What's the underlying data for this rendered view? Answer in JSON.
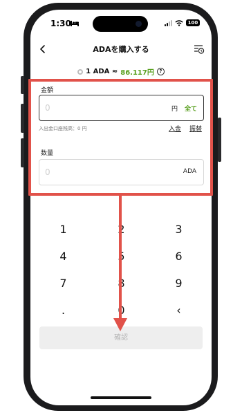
{
  "status_bar": {
    "time": "1:30",
    "battery": "100"
  },
  "nav": {
    "title": "ADAを購入する"
  },
  "rate": {
    "lead": "1 ADA ≈",
    "value": "86.117円"
  },
  "amount": {
    "label": "金額",
    "placeholder": "0",
    "unit": "円",
    "all_label": "全て",
    "balance_text": "入出金口座残高：0 円",
    "deposit_label": "入金",
    "transfer_label": "振替"
  },
  "quantity": {
    "label": "数量",
    "placeholder": "0",
    "unit": "ADA"
  },
  "keypad": {
    "keys": [
      "1",
      "2",
      "3",
      "4",
      "5",
      "6",
      "7",
      "8",
      "9",
      ".",
      "0",
      "‹"
    ]
  },
  "confirm": {
    "label": "確認"
  },
  "annotation": {
    "color": "#e1524a"
  },
  "colors": {
    "accent_green": "#59a01f"
  },
  "icons": {
    "status": [
      "bed-icon",
      "signal-icon",
      "wifi-icon",
      "battery-icon"
    ],
    "nav": [
      "back-icon",
      "history-icon"
    ],
    "rate": [
      "coin-icon",
      "help-icon"
    ]
  }
}
